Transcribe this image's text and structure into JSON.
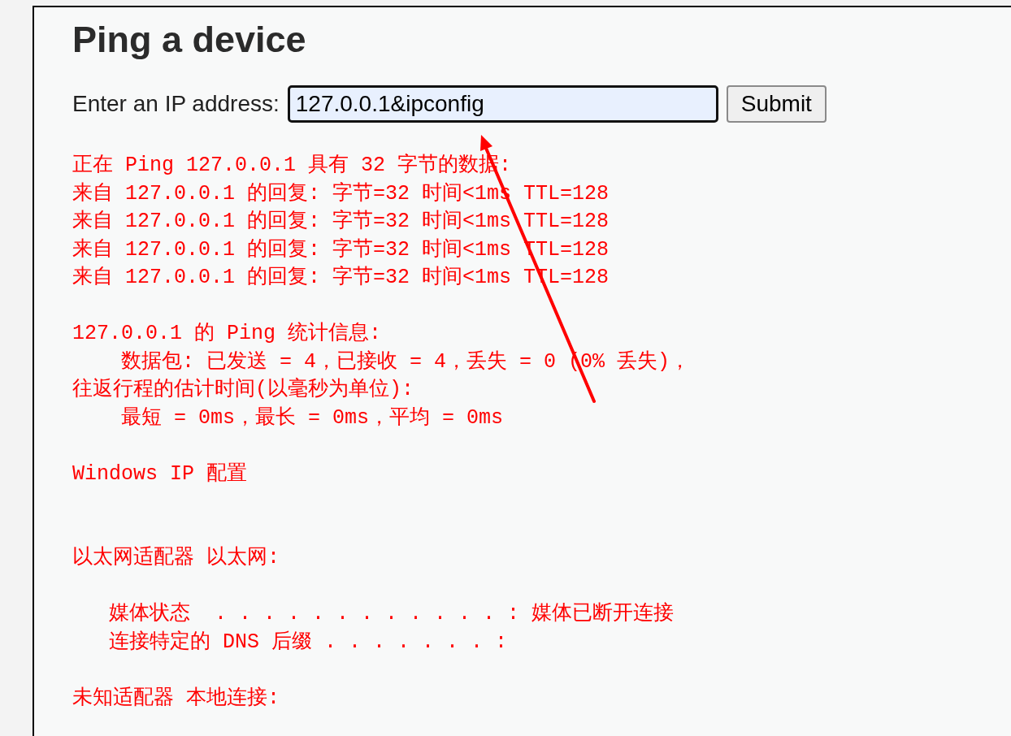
{
  "title": "Ping a device",
  "form": {
    "label": "Enter an IP address:",
    "value": "127.0.0.1&ipconfig",
    "button": "Submit"
  },
  "output": [
    {
      "kind": "line",
      "text": "正在 Ping 127.0.0.1 具有 32 字节的数据:"
    },
    {
      "kind": "line",
      "text": "来自 127.0.0.1 的回复: 字节=32 时间<1ms TTL=128"
    },
    {
      "kind": "line",
      "text": "来自 127.0.0.1 的回复: 字节=32 时间<1ms TTL=128"
    },
    {
      "kind": "line",
      "text": "来自 127.0.0.1 的回复: 字节=32 时间<1ms TTL=128"
    },
    {
      "kind": "line",
      "text": "来自 127.0.0.1 的回复: 字节=32 时间<1ms TTL=128"
    },
    {
      "kind": "blank"
    },
    {
      "kind": "line",
      "text": "127.0.0.1 的 Ping 统计信息:"
    },
    {
      "kind": "line",
      "text": "    数据包: 已发送 = 4，已接收 = 4，丢失 = 0 (0% 丢失)，"
    },
    {
      "kind": "line",
      "text": "往返行程的估计时间(以毫秒为单位):"
    },
    {
      "kind": "line",
      "text": "    最短 = 0ms，最长 = 0ms，平均 = 0ms"
    },
    {
      "kind": "blank"
    },
    {
      "kind": "line",
      "text": "Windows IP 配置"
    },
    {
      "kind": "blank"
    },
    {
      "kind": "blank"
    },
    {
      "kind": "line",
      "text": "以太网适配器 以太网:"
    },
    {
      "kind": "blank"
    },
    {
      "kind": "line",
      "text": "   媒体状态  . . . . . . . . . . . . : 媒体已断开连接"
    },
    {
      "kind": "line",
      "text": "   连接特定的 DNS 后缀 . . . . . . . :"
    },
    {
      "kind": "blank"
    },
    {
      "kind": "line",
      "text": "未知适配器 本地连接:"
    }
  ]
}
